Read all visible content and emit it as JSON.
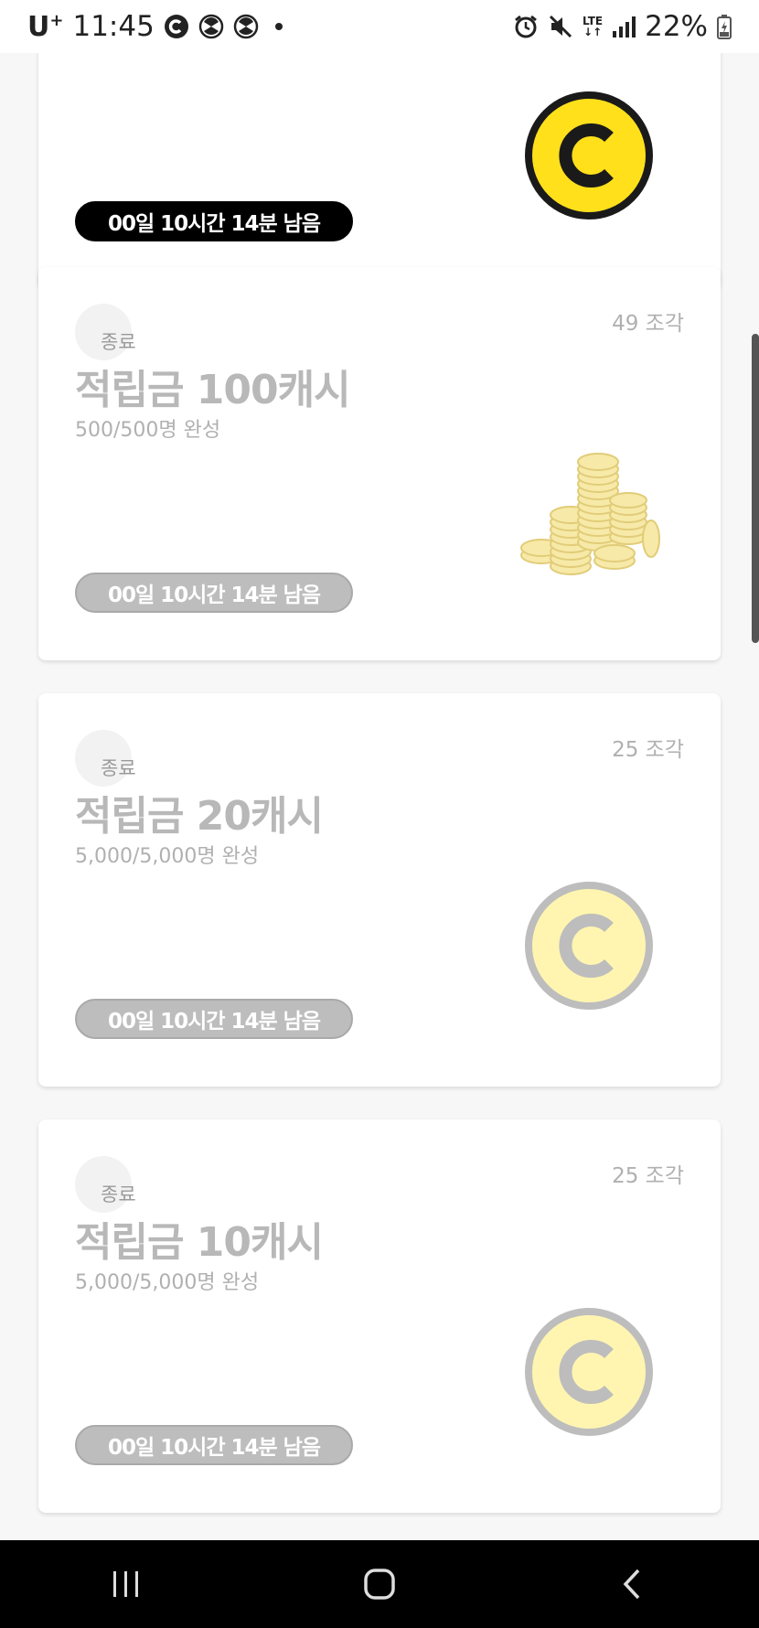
{
  "status_bar": {
    "carrier": "U",
    "carrier_sup": "+",
    "time": "11:45",
    "battery": "22%",
    "network": "LTE"
  },
  "cards": [
    {
      "timer": "00일 10시간 14분 남음",
      "active": true,
      "art": "coin-icon"
    },
    {
      "status": "종료",
      "pieces": "49 조각",
      "title": "적립금 100캐시",
      "subtitle": "500/500명 완성",
      "timer": "00일 10시간 14분 남음",
      "art": "coin-pile-image"
    },
    {
      "status": "종료",
      "pieces": "25 조각",
      "title": "적립금 20캐시",
      "subtitle": "5,000/5,000명 완성",
      "timer": "00일 10시간 14분 남음",
      "art": "coin-icon"
    },
    {
      "status": "종료",
      "pieces": "25 조각",
      "title": "적립금 10캐시",
      "subtitle": "5,000/5,000명 완성",
      "timer": "00일 10시간 14분 남음",
      "art": "coin-icon"
    }
  ],
  "colors": {
    "coin_active": "#FFE01B",
    "coin_inactive": "#FFF5B0",
    "timer_active": "#000000",
    "timer_inactive": "#BDBDBD"
  }
}
